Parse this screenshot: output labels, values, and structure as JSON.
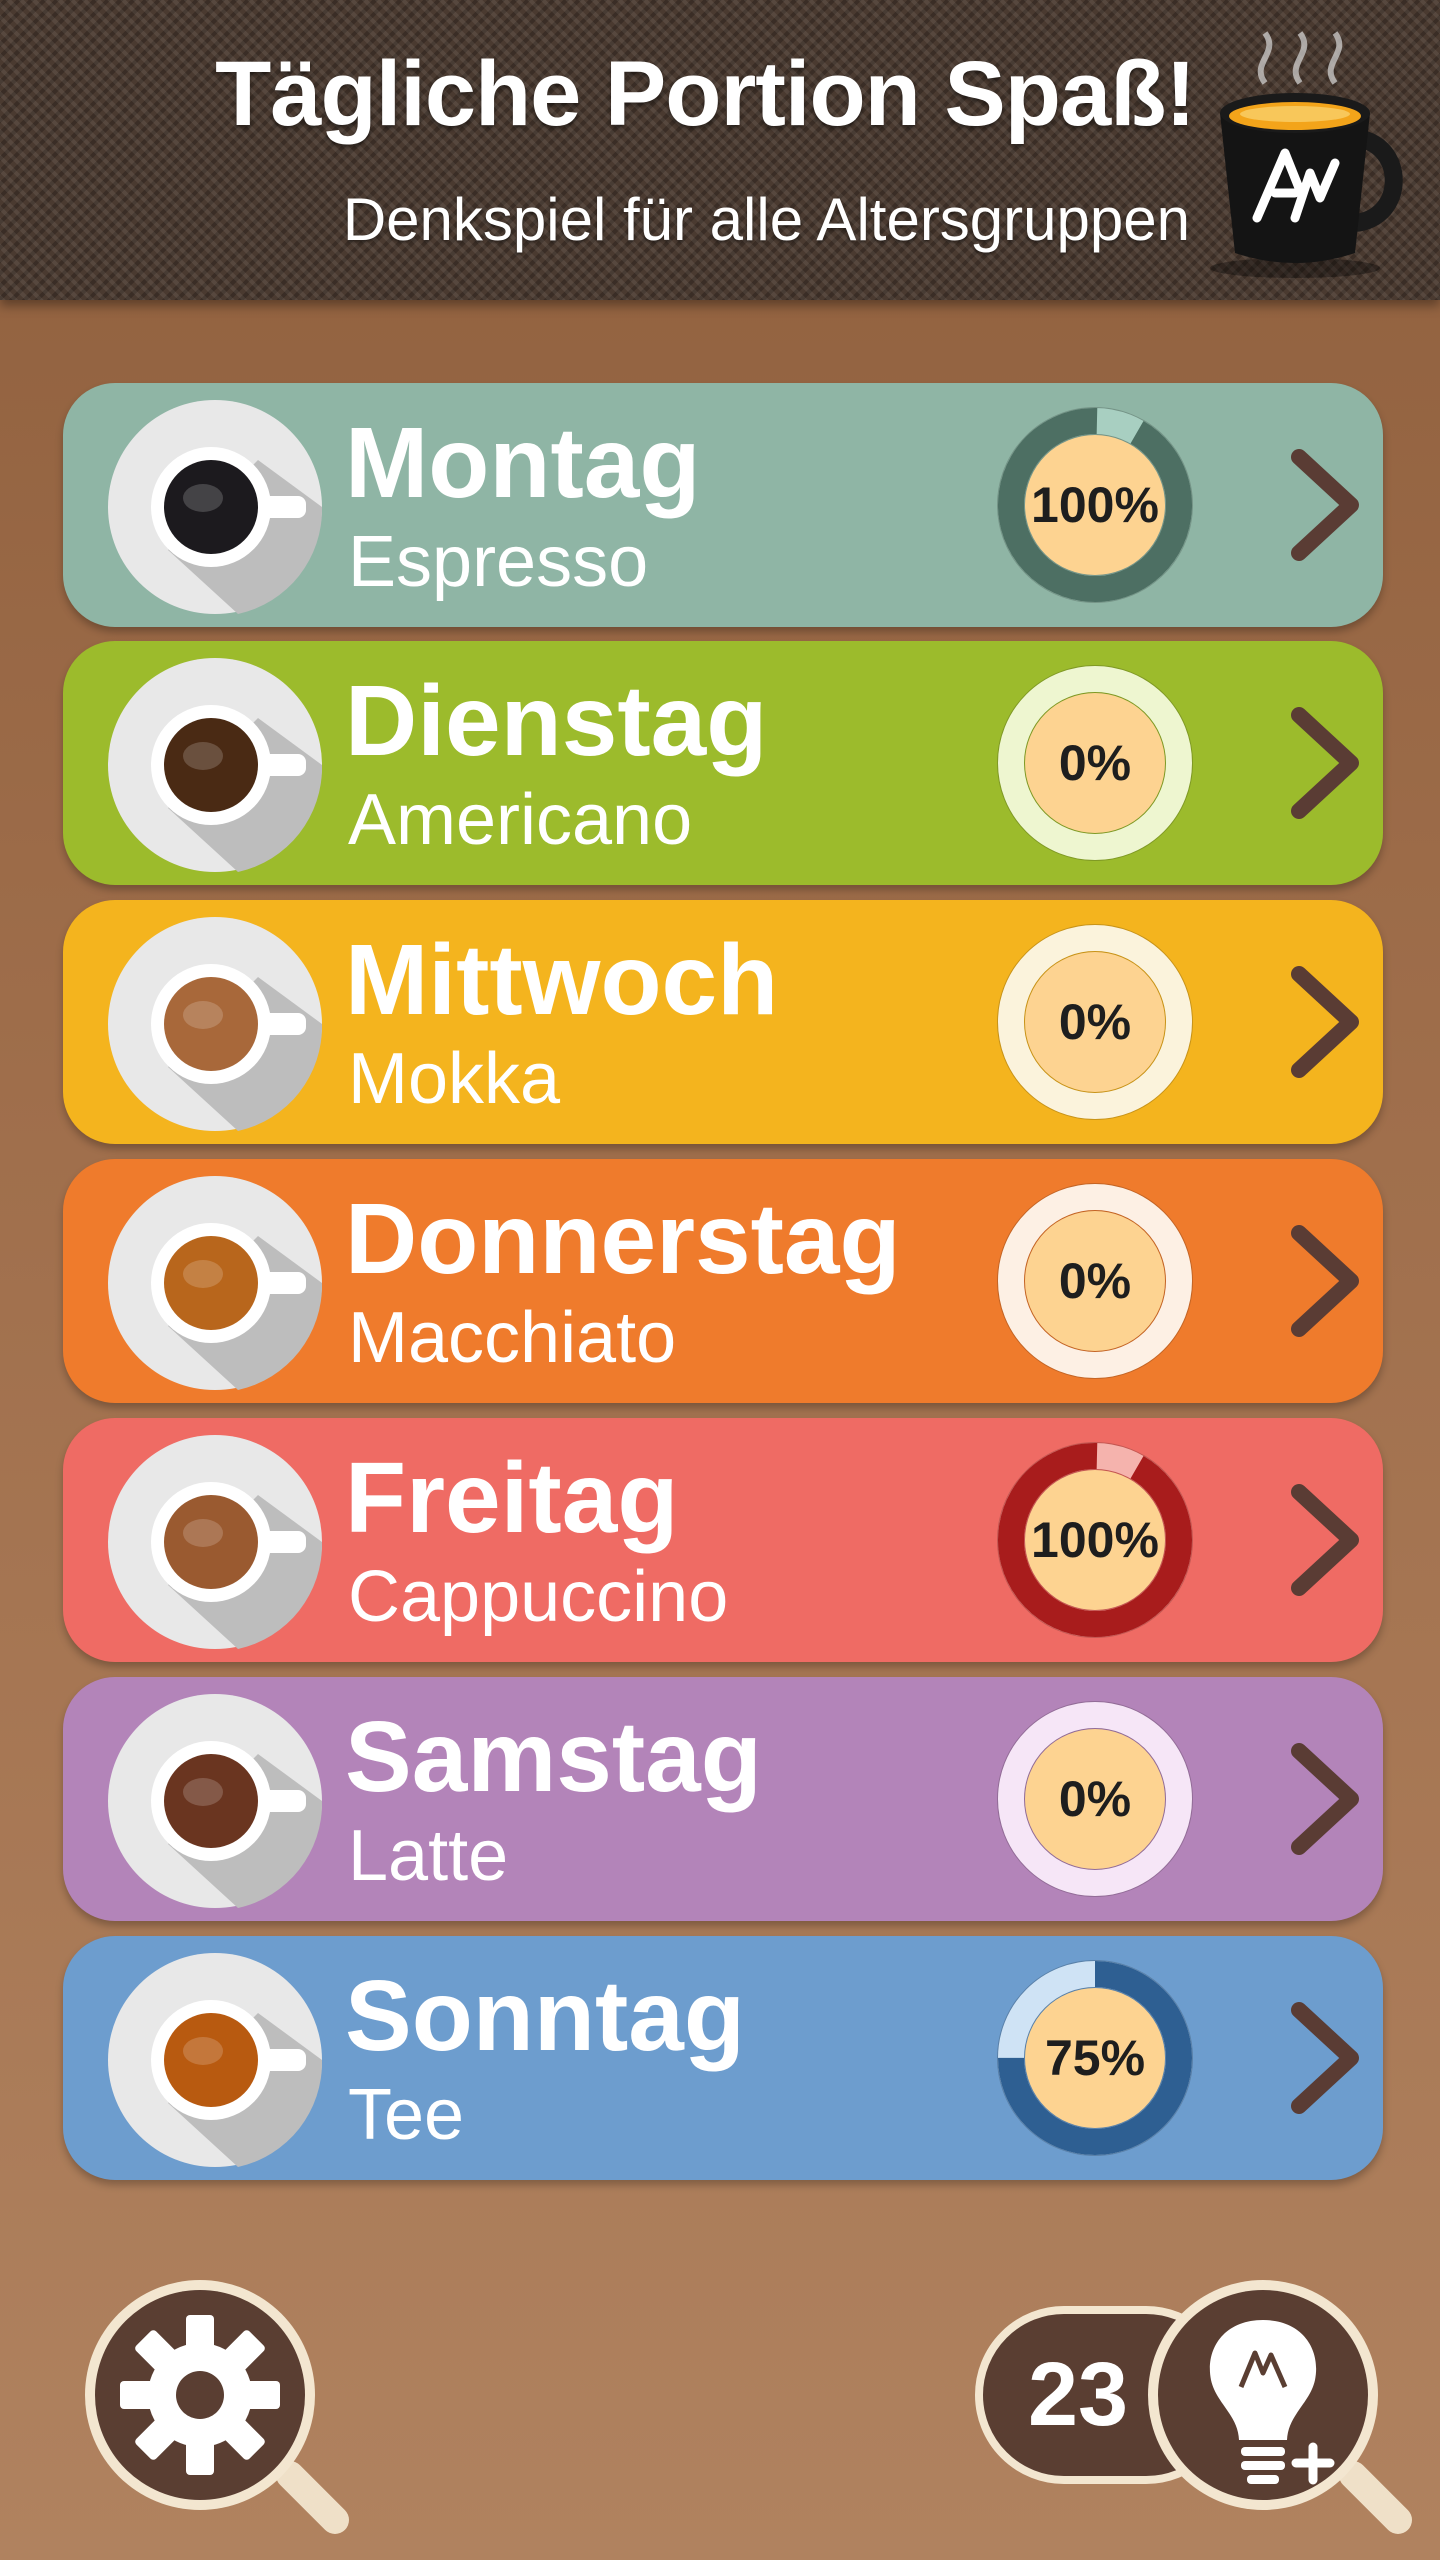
{
  "header": {
    "title": "Tägliche Portion Spaß!",
    "subtitle": "Denkspiel für alle Altersgruppen",
    "logo_icon": "coffee-cup-logo-icon"
  },
  "days": [
    {
      "day": "Montag",
      "drink": "Espresso",
      "progress": "100%",
      "progress_value": 100,
      "row_color": "#8fb5a5",
      "ring_color": "#4d6f63",
      "ring_track": "#a8cfc1",
      "coffee_color": "#1c1a1e",
      "cup_icon": "espresso-cup-icon"
    },
    {
      "day": "Dienstag",
      "drink": "Americano",
      "progress": "0%",
      "progress_value": 0,
      "row_color": "#9cbb2c",
      "ring_color": "#4d6f63",
      "ring_track": "#eef6d0",
      "coffee_color": "#4a2a14",
      "cup_icon": "americano-cup-icon"
    },
    {
      "day": "Mittwoch",
      "drink": "Mokka",
      "progress": "0%",
      "progress_value": 0,
      "row_color": "#f4b41e",
      "ring_color": "#a07010",
      "ring_track": "#fbf3dc",
      "coffee_color": "#a8683a",
      "cup_icon": "mokka-cup-icon"
    },
    {
      "day": "Donnerstag",
      "drink": "Macchiato",
      "progress": "0%",
      "progress_value": 0,
      "row_color": "#ef7b2c",
      "ring_color": "#a04e10",
      "ring_track": "#fdf0e4",
      "coffee_color": "#b8661c",
      "cup_icon": "macchiato-cup-icon"
    },
    {
      "day": "Freitag",
      "drink": "Cappuccino",
      "progress": "100%",
      "progress_value": 100,
      "row_color": "#ef6b64",
      "ring_color": "#a81c1c",
      "ring_track": "#f5b3ad",
      "coffee_color": "#9a5a30",
      "cup_icon": "cappuccino-cup-icon"
    },
    {
      "day": "Samstag",
      "drink": "Latte",
      "progress": "0%",
      "progress_value": 0,
      "row_color": "#b384b9",
      "ring_color": "#7a4a80",
      "ring_track": "#f6e6f7",
      "coffee_color": "#6a3520",
      "cup_icon": "latte-cup-icon"
    },
    {
      "day": "Sonntag",
      "drink": "Tee",
      "progress": "75%",
      "progress_value": 75,
      "row_color": "#6d9dce",
      "ring_color": "#2e5f92",
      "ring_track": "#cfe3f5",
      "coffee_color": "#b85a10",
      "cup_icon": "tea-cup-icon"
    }
  ],
  "footer": {
    "settings_icon": "gear-icon",
    "hint_count": "23",
    "hint_icon": "lightbulb-plus-icon"
  }
}
